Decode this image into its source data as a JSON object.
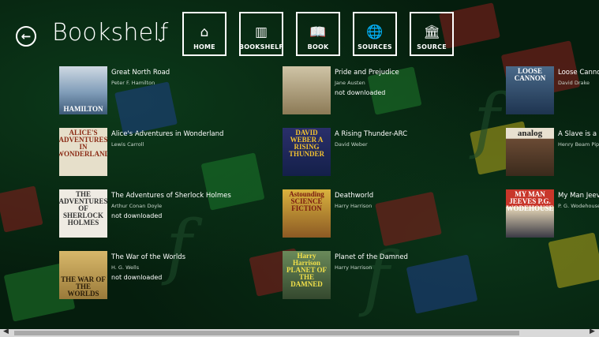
{
  "header": {
    "back_icon": "back-arrow-icon",
    "title": "Bookshelf",
    "title_chevron_icon": "chevron-down-icon"
  },
  "nav": [
    {
      "label": "HOME",
      "icon": "⌂",
      "icon_name": "home-icon"
    },
    {
      "label": "BOOKSHELF",
      "icon": "▥",
      "icon_name": "bookshelf-icon"
    },
    {
      "label": "BOOK",
      "icon": "📖",
      "icon_name": "book-icon"
    },
    {
      "label": "SOURCES",
      "icon": "🌐",
      "icon_name": "globe-icon"
    },
    {
      "label": "SOURCE",
      "icon": "🏛",
      "icon_name": "library-icon"
    }
  ],
  "books": [
    {
      "title": "Great North Road",
      "author": "Peter F. Hamilton",
      "status": "",
      "cover_text": "HAMILTON",
      "cover_bg": "#6f8aa5",
      "cover_fg": "#ffffff"
    },
    {
      "title": "Alice's Adventures in Wonderland",
      "author": "Lewis Carroll",
      "status": "",
      "cover_text": "ALICE'S ADVENTURES IN WONDERLAND",
      "cover_bg": "#e3dcc8",
      "cover_fg": "#7a2a16"
    },
    {
      "title": "The Adventures of Sherlock Holmes",
      "author": "Arthur Conan Doyle",
      "status": "not downloaded",
      "cover_text": "THE ADVENTURES OF SHERLOCK HOLMES",
      "cover_bg": "#efebe3",
      "cover_fg": "#333333"
    },
    {
      "title": "The War of the Worlds",
      "author": "H. G. Wells",
      "status": "not downloaded",
      "cover_text": "THE WAR OF THE WORLDS",
      "cover_bg": "#b8964e",
      "cover_fg": "#2a1c08"
    },
    {
      "title": "Pride and Prejudice",
      "author": "Jane Austen",
      "status": "not downloaded",
      "cover_text": "",
      "cover_bg": "#a89a7a",
      "cover_fg": "#ffffff"
    },
    {
      "title": "A Rising Thunder-ARC",
      "author": "David Weber",
      "status": "",
      "cover_text": "DAVID WEBER A RISING THUNDER",
      "cover_bg": "#1f2a5e",
      "cover_fg": "#f2c230"
    },
    {
      "title": "Deathworld",
      "author": "Harry Harrison",
      "status": "",
      "cover_text": "Astounding SCIENCE FICTION",
      "cover_bg": "#c9a53a",
      "cover_fg": "#7a1a10"
    },
    {
      "title": "Planet of the Damned",
      "author": "Harry Harrison",
      "status": "",
      "cover_text": "Harry Harrison PLANET OF THE DAMNED",
      "cover_bg": "#4f6a4a",
      "cover_fg": "#f2e04a"
    },
    {
      "title": "Loose Cannon",
      "author": "David Drake",
      "status": "",
      "cover_text": "LOOSE CANNON",
      "cover_bg": "#3a5a7a",
      "cover_fg": "#ffffff"
    },
    {
      "title": "A Slave is a Sla",
      "author": "Henry Beam Pipe",
      "status": "",
      "cover_text": "analog",
      "cover_bg": "#5a4030",
      "cover_fg": "#ffffff"
    },
    {
      "title": "My Man Jeeve",
      "author": "P. G. Wodehouse",
      "status": "",
      "cover_text": "MY MAN JEEVES P.G. WODEHOUSE",
      "cover_bg": "#c23a2e",
      "cover_fg": "#ffffff"
    }
  ]
}
